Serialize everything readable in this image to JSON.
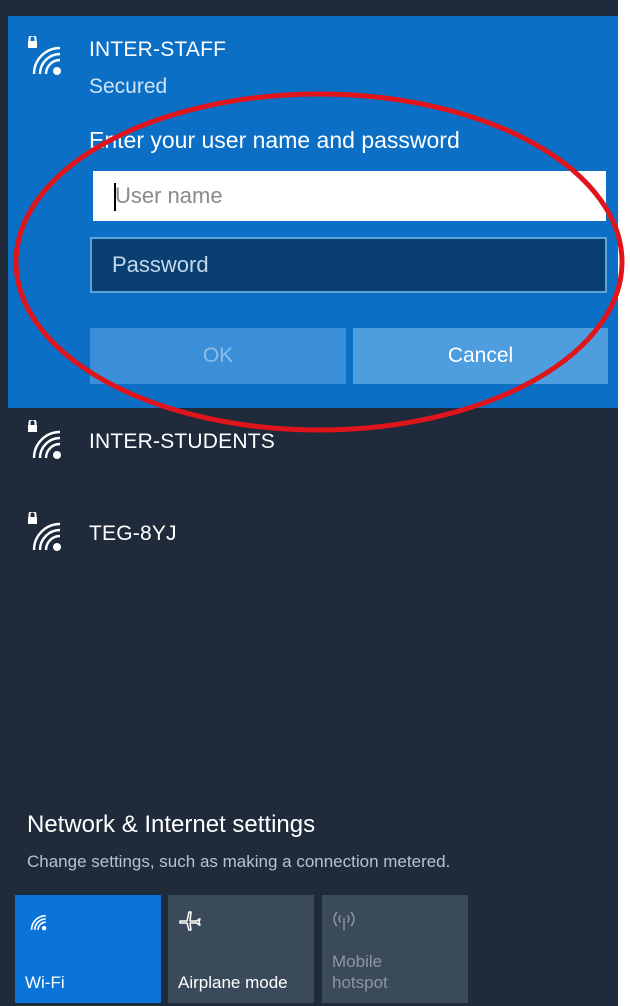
{
  "networks": {
    "expanded": {
      "ssid": "INTER-STAFF",
      "status": "Secured",
      "prompt": "Enter your user name and password",
      "username_placeholder": "User name",
      "password_placeholder": "Password",
      "ok_label": "OK",
      "cancel_label": "Cancel"
    },
    "list": [
      {
        "ssid": "INTER-STUDENTS",
        "icon": "wifi-secured-icon"
      },
      {
        "ssid": "TEG-8YJ",
        "icon": "wifi-secured-icon"
      }
    ]
  },
  "settings": {
    "title": "Network & Internet settings",
    "subtitle": "Change settings, such as making a connection metered."
  },
  "quick_actions": [
    {
      "label": "Wi-Fi",
      "icon": "wifi-icon",
      "active": true
    },
    {
      "label": "Airplane mode",
      "icon": "airplane-icon",
      "active": false
    },
    {
      "label": "Mobile hotspot",
      "icon": "hotspot-icon",
      "active": false,
      "disabled": true
    }
  ],
  "colors": {
    "accent": "#0b6fc6",
    "flyout_bg": "#1f2b3b",
    "tile_inactive": "#3b4a5b",
    "annotation": "#e0141b"
  }
}
